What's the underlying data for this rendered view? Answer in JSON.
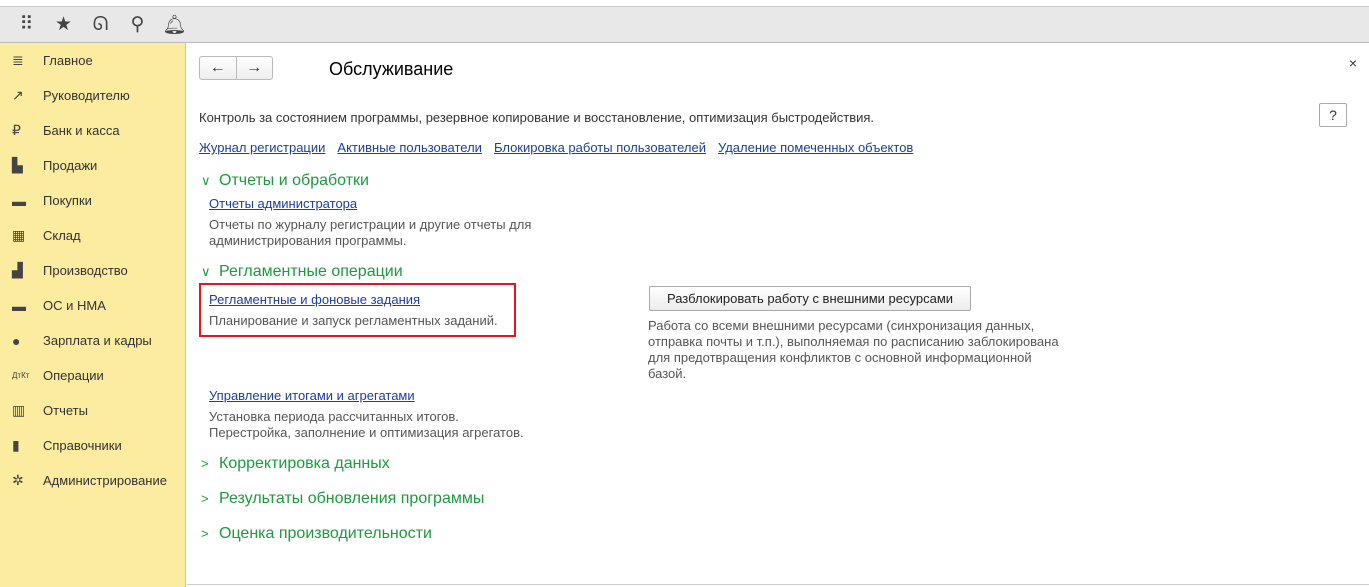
{
  "topbar": {
    "icons": [
      "apps-grid-icon",
      "star-icon",
      "history-icon",
      "search-icon",
      "bell-icon"
    ]
  },
  "sidebar": {
    "items": [
      {
        "label": "Главное",
        "icon": "menu-icon",
        "glyph": "≣"
      },
      {
        "label": "Руководителю",
        "icon": "trend-icon",
        "glyph": "↗"
      },
      {
        "label": "Банк и касса",
        "icon": "ruble-icon",
        "glyph": "₽"
      },
      {
        "label": "Продажи",
        "icon": "bag-icon",
        "glyph": "▙"
      },
      {
        "label": "Покупки",
        "icon": "cart-icon",
        "glyph": "▬"
      },
      {
        "label": "Склад",
        "icon": "warehouse-icon",
        "glyph": "▦"
      },
      {
        "label": "Производство",
        "icon": "factory-icon",
        "glyph": "▟"
      },
      {
        "label": "ОС и НМА",
        "icon": "truck-icon",
        "glyph": "▬"
      },
      {
        "label": "Зарплата и кадры",
        "icon": "person-icon",
        "glyph": "●"
      },
      {
        "label": "Операции",
        "icon": "dt-kt-icon",
        "glyph": "ДтКт"
      },
      {
        "label": "Отчеты",
        "icon": "bar-chart-icon",
        "glyph": "▥"
      },
      {
        "label": "Справочники",
        "icon": "books-icon",
        "glyph": "▮"
      },
      {
        "label": "Администрирование",
        "icon": "gear-icon",
        "glyph": "✲"
      }
    ]
  },
  "main": {
    "title": "Обслуживание",
    "help": "?",
    "close": "×",
    "description": "Контроль за состоянием программы, резервное копирование и восстановление, оптимизация быстродействия.",
    "links": [
      "Журнал регистрации",
      "Активные пользователи",
      "Блокировка работы пользователей",
      "Удаление помеченных объектов"
    ],
    "sections": {
      "reports": {
        "title": "Отчеты и обработки",
        "link": "Отчеты администратора",
        "text1": "Отчеты по журналу регистрации и другие отчеты для",
        "text2": "администрирования программы."
      },
      "routine": {
        "title": "Регламентные операции",
        "link": "Регламентные и фоновые задания",
        "text": "Планирование и запуск регламентных заданий.",
        "button": "Разблокировать работу с внешними ресурсами",
        "btn_text1": "Работа со всеми внешними ресурсами (синхронизация данных,",
        "btn_text2": "отправка почты и т.п.), выполняемая по расписанию заблокирована",
        "btn_text3": "для предотвращения конфликтов с основной информационной",
        "btn_text4": "базой.",
        "link2": "Управление итогами и агрегатами",
        "text2a": "Установка периода рассчитанных итогов.",
        "text2b": "Перестройка, заполнение и оптимизация агрегатов."
      },
      "correction": {
        "title": "Корректировка данных"
      },
      "update": {
        "title": "Результаты обновления программы"
      },
      "perf": {
        "title": "Оценка производительности"
      }
    }
  }
}
